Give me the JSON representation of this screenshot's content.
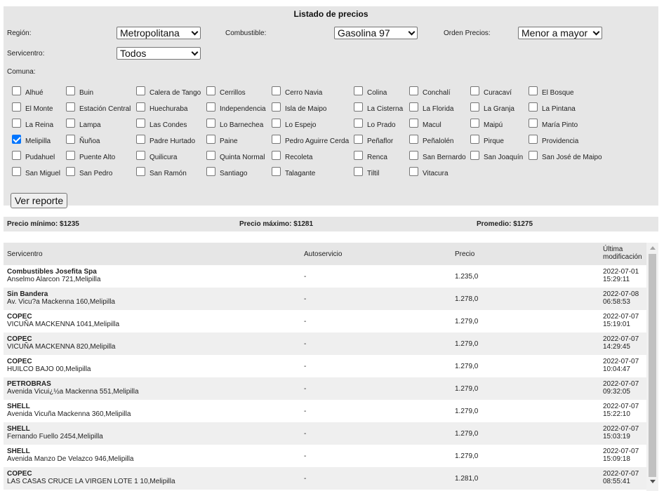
{
  "header": {
    "title": "Listado de precios"
  },
  "filters": {
    "region_label": "Región:",
    "region_value": "Metropolitana",
    "combustible_label": "Combustible:",
    "combustible_value": "Gasolina 97",
    "orden_label": "Orden Precios:",
    "orden_value": "Menor a mayor",
    "servicentro_label": "Servicentro:",
    "servicentro_value": "Todos",
    "comuna_label": "Comuna:"
  },
  "comunas": [
    {
      "label": "Alhué",
      "checked": false
    },
    {
      "label": "Buin",
      "checked": false
    },
    {
      "label": "Calera de Tango",
      "checked": false
    },
    {
      "label": "Cerrillos",
      "checked": false
    },
    {
      "label": "Cerro Navia",
      "checked": false
    },
    {
      "label": "Colina",
      "checked": false
    },
    {
      "label": "Conchalí",
      "checked": false
    },
    {
      "label": "Curacaví",
      "checked": false
    },
    {
      "label": "El Bosque",
      "checked": false
    },
    {
      "label": "El Monte",
      "checked": false
    },
    {
      "label": "Estación Central",
      "checked": false
    },
    {
      "label": "Huechuraba",
      "checked": false
    },
    {
      "label": "Independencia",
      "checked": false
    },
    {
      "label": "Isla de Maipo",
      "checked": false
    },
    {
      "label": "La Cisterna",
      "checked": false
    },
    {
      "label": "La Florida",
      "checked": false
    },
    {
      "label": "La Granja",
      "checked": false
    },
    {
      "label": "La Pintana",
      "checked": false
    },
    {
      "label": "La Reina",
      "checked": false
    },
    {
      "label": "Lampa",
      "checked": false
    },
    {
      "label": "Las Condes",
      "checked": false
    },
    {
      "label": "Lo Barnechea",
      "checked": false
    },
    {
      "label": "Lo Espejo",
      "checked": false
    },
    {
      "label": "Lo Prado",
      "checked": false
    },
    {
      "label": "Macul",
      "checked": false
    },
    {
      "label": "Maipú",
      "checked": false
    },
    {
      "label": "María Pinto",
      "checked": false
    },
    {
      "label": "Melipilla",
      "checked": true
    },
    {
      "label": "Ñuñoa",
      "checked": false
    },
    {
      "label": "Padre Hurtado",
      "checked": false
    },
    {
      "label": "Paine",
      "checked": false
    },
    {
      "label": "Pedro Aguirre Cerda",
      "checked": false
    },
    {
      "label": "Peñaflor",
      "checked": false
    },
    {
      "label": "Peñalolén",
      "checked": false
    },
    {
      "label": "Pirque",
      "checked": false
    },
    {
      "label": "Providencia",
      "checked": false
    },
    {
      "label": "Pudahuel",
      "checked": false
    },
    {
      "label": "Puente Alto",
      "checked": false
    },
    {
      "label": "Quilicura",
      "checked": false
    },
    {
      "label": "Quinta Normal",
      "checked": false
    },
    {
      "label": "Recoleta",
      "checked": false
    },
    {
      "label": "Renca",
      "checked": false
    },
    {
      "label": "San Bernardo",
      "checked": false
    },
    {
      "label": "San Joaquín",
      "checked": false
    },
    {
      "label": "San José de Maipo",
      "checked": false
    },
    {
      "label": "San Miguel",
      "checked": false
    },
    {
      "label": "San Pedro",
      "checked": false
    },
    {
      "label": "San Ramón",
      "checked": false
    },
    {
      "label": "Santiago",
      "checked": false
    },
    {
      "label": "Talagante",
      "checked": false
    },
    {
      "label": "Tiltil",
      "checked": false
    },
    {
      "label": "Vitacura",
      "checked": false
    }
  ],
  "report_button": "Ver reporte",
  "stats": {
    "min": "Precio mínimo: $1235",
    "max": "Precio máximo: $1281",
    "avg": "Promedio: $1275"
  },
  "table": {
    "headers": {
      "servicentro": "Servicentro",
      "autoservicio": "Autoservicio",
      "precio": "Precio",
      "modificacion_1": "Última",
      "modificacion_2": "modificación"
    },
    "rows": [
      {
        "name": "Combustibles Josefita Spa",
        "address": "Anselmo Alarcon 721,Melipilla",
        "auto": "-",
        "price": "1.235,0",
        "date": "2022-07-01",
        "time": "15:29:11"
      },
      {
        "name": "Sin Bandera",
        "address": "Av. Vicu?a Mackenna 160,Melipilla",
        "auto": "-",
        "price": "1.278,0",
        "date": "2022-07-08",
        "time": "06:58:53"
      },
      {
        "name": "COPEC",
        "address": "VICUÑA MACKENNA 1041,Melipilla",
        "auto": "-",
        "price": "1.279,0",
        "date": "2022-07-07",
        "time": "15:19:01"
      },
      {
        "name": "COPEC",
        "address": "VICUÑA MACKENNA 820,Melipilla",
        "auto": "-",
        "price": "1.279,0",
        "date": "2022-07-07",
        "time": "14:29:45"
      },
      {
        "name": "COPEC",
        "address": "HUILCO BAJO 00,Melipilla",
        "auto": "-",
        "price": "1.279,0",
        "date": "2022-07-07",
        "time": "10:04:47"
      },
      {
        "name": "PETROBRAS",
        "address": "Avenida Vicui¿½a Mackenna 551,Melipilla",
        "auto": "-",
        "price": "1.279,0",
        "date": "2022-07-07",
        "time": "09:32:05"
      },
      {
        "name": "SHELL",
        "address": "Avenida Vicuña Mackenna 360,Melipilla",
        "auto": "-",
        "price": "1.279,0",
        "date": "2022-07-07",
        "time": "15:22:10"
      },
      {
        "name": "SHELL",
        "address": "Fernando Fuello 2454,Melipilla",
        "auto": "-",
        "price": "1.279,0",
        "date": "2022-07-07",
        "time": "15:03:19"
      },
      {
        "name": "SHELL",
        "address": "Avenida Manzo De Velazco 946,Melipilla",
        "auto": "-",
        "price": "1.279,0",
        "date": "2022-07-07",
        "time": "15:09:18"
      },
      {
        "name": "COPEC",
        "address": "LAS CASAS CRUCE LA VIRGEN LOTE 1 10,Melipilla",
        "auto": "-",
        "price": "1.281,0",
        "date": "2022-07-07",
        "time": "08:55:41"
      }
    ]
  }
}
